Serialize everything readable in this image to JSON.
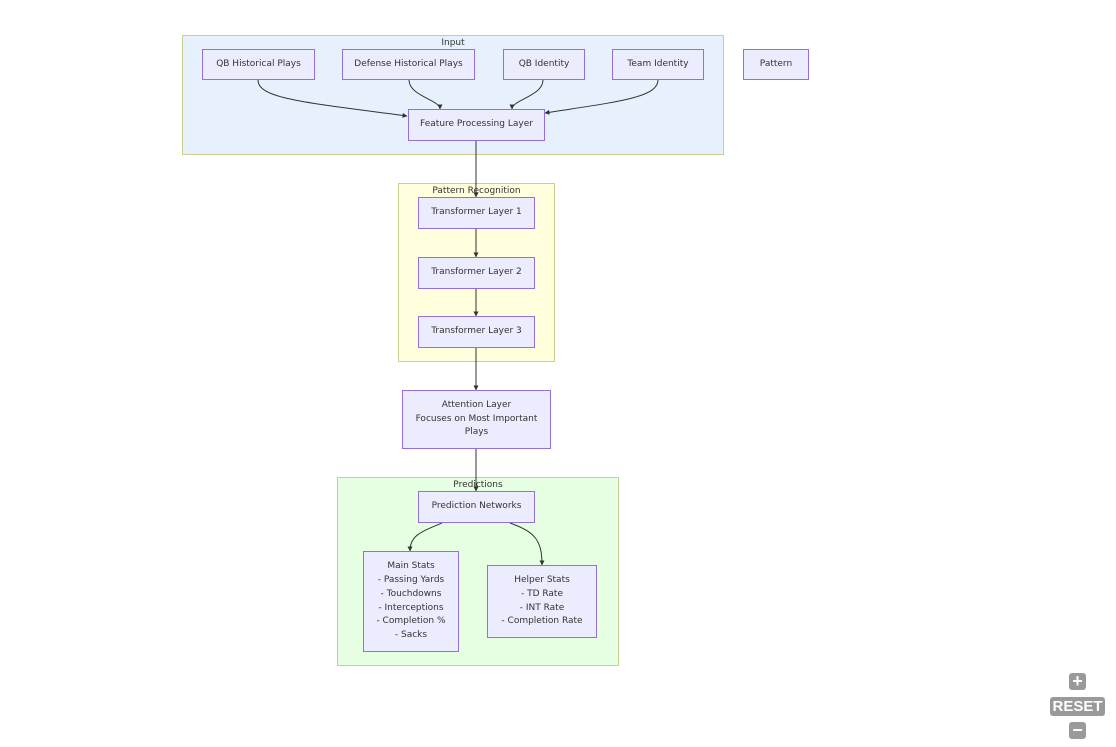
{
  "diagram": {
    "clusters": {
      "input": {
        "label": "Input",
        "fill": "#E6F1FD",
        "stroke": "#C9CF8E"
      },
      "pattern_recognition": {
        "label": "Pattern Recognition",
        "fill": "#FFFFDE",
        "stroke": "#C9CF8E"
      },
      "predictions": {
        "label": "Predictions",
        "fill": "#E6FFE3",
        "stroke": "#C9CF8E"
      }
    },
    "nodes": {
      "qb_historical_plays": "QB Historical Plays",
      "defense_historical_plays": "Defense Historical Plays",
      "qb_identity": "QB Identity",
      "team_identity": "Team Identity",
      "pattern": "Pattern",
      "feature_processing_layer": "Feature Processing Layer",
      "transformer_layer_1": "Transformer Layer 1",
      "transformer_layer_2": "Transformer Layer 2",
      "transformer_layer_3": "Transformer Layer 3",
      "attention_layer": "Attention Layer\nFocuses on Most Important\nPlays",
      "prediction_networks": "Prediction Networks",
      "main_stats": "Main Stats\n- Passing Yards\n- Touchdowns\n- Interceptions\n- Completion %\n- Sacks",
      "helper_stats": "Helper Stats\n- TD Rate\n- INT Rate\n- Completion Rate"
    },
    "edges": [
      {
        "from": "QB Historical Plays",
        "to": "Feature Processing Layer"
      },
      {
        "from": "Defense Historical Plays",
        "to": "Feature Processing Layer"
      },
      {
        "from": "QB Identity",
        "to": "Feature Processing Layer"
      },
      {
        "from": "Team Identity",
        "to": "Feature Processing Layer"
      },
      {
        "from": "Feature Processing Layer",
        "to": "Transformer Layer 1"
      },
      {
        "from": "Transformer Layer 1",
        "to": "Transformer Layer 2"
      },
      {
        "from": "Transformer Layer 2",
        "to": "Transformer Layer 3"
      },
      {
        "from": "Transformer Layer 3",
        "to": "Attention Layer"
      },
      {
        "from": "Attention Layer",
        "to": "Prediction Networks"
      },
      {
        "from": "Prediction Networks",
        "to": "Main Stats"
      },
      {
        "from": "Prediction Networks",
        "to": "Helper Stats"
      }
    ],
    "colors": {
      "node_fill": "#ECECFF",
      "node_stroke": "#9370DB",
      "edge": "#333333"
    }
  },
  "controls": {
    "zoom_in": "+",
    "reset": "RESET",
    "zoom_out": "−"
  }
}
